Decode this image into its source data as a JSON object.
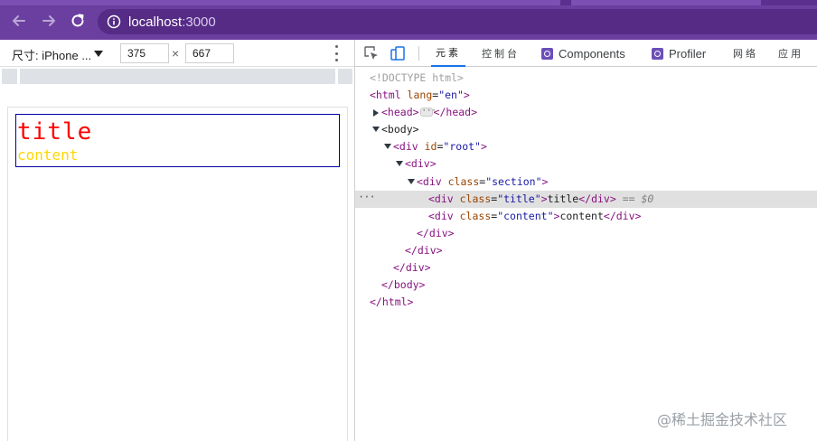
{
  "browser": {
    "url_host": "localhost",
    "url_port": ":3000"
  },
  "device_toolbar": {
    "device_label": "尺寸: iPhone ...",
    "width": "375",
    "height": "667",
    "times": "×"
  },
  "page": {
    "title": "title",
    "content": "content",
    "title_color": "#ff0000",
    "content_color": "#ffd700",
    "section_border_color": "#0000aa"
  },
  "devtools": {
    "tabs": {
      "elements": "元素",
      "console": "控制台",
      "components": "Components",
      "profiler": "Profiler",
      "network": "网络",
      "application": "应用"
    },
    "dom": {
      "doctype": "<!DOCTYPE html>",
      "html_open_tag": "<html",
      "lang_attr": " lang",
      "lang_val": "\"en\"",
      "head_open": "<head>",
      "head_close": "</head>",
      "body_open": "<body>",
      "div_open": "<div",
      "id_attr": " id",
      "root_val": "\"root\"",
      "div_plain_open": "<div>",
      "class_attr": " class",
      "section_val": "\"section\"",
      "title_val": "\"title\"",
      "title_text": "title",
      "div_close": "</div>",
      "eq_ref": " == ",
      "ref_name": "$0",
      "content_val": "\"content\"",
      "content_text": "content",
      "body_close": "</body>",
      "html_close": "</html>",
      "gt": ">",
      "eq": "="
    }
  },
  "watermark": "@稀土掘金技术社区"
}
